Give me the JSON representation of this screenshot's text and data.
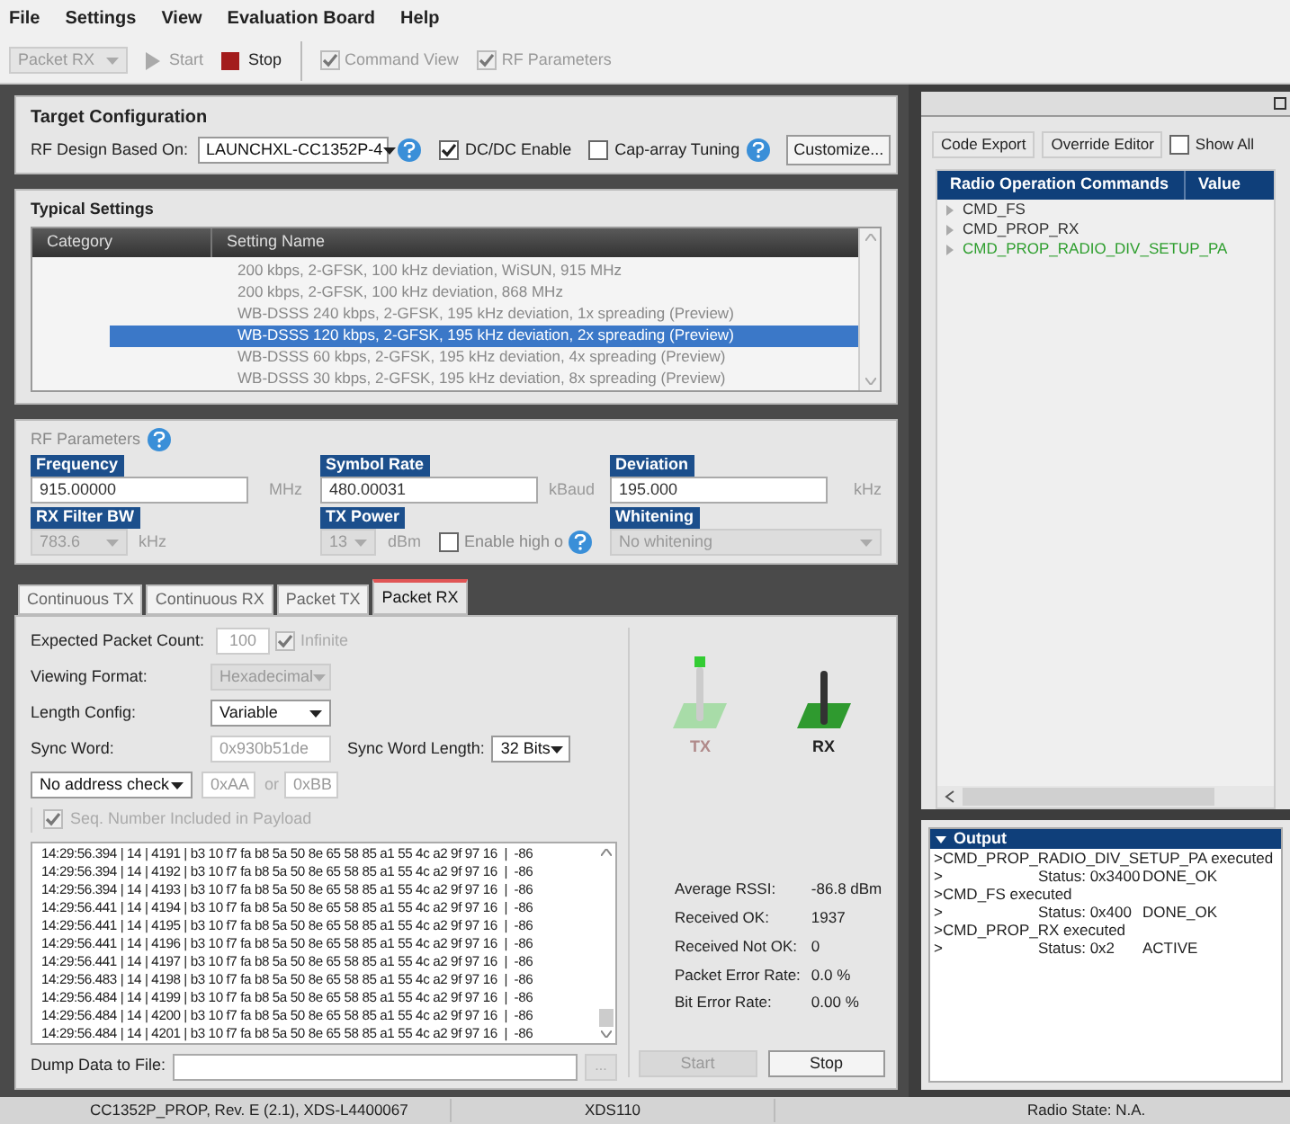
{
  "menu": [
    "File",
    "Settings",
    "View",
    "Evaluation Board",
    "Help"
  ],
  "toolbar": {
    "mode": {
      "value": "Packet RX",
      "disabled": true
    },
    "start": {
      "label": "Start",
      "disabled": true
    },
    "stop": {
      "label": "Stop",
      "disabled": false
    },
    "checks": [
      {
        "label": "Command View",
        "checked": true,
        "disabled": true
      },
      {
        "label": "RF Parameters",
        "checked": true,
        "disabled": true
      }
    ]
  },
  "target_configuration": {
    "title": "Target Configuration",
    "label": "RF Design Based On:",
    "board": "LAUNCHXL-CC1352P-4",
    "checks": [
      {
        "label": "DC/DC Enable",
        "checked": true,
        "help": false
      },
      {
        "label": "Cap-array Tuning",
        "checked": false,
        "help": true
      }
    ],
    "customize": "Customize..."
  },
  "typical_settings": {
    "title": "Typical Settings",
    "columns": [
      "Category",
      "Setting Name"
    ],
    "rows": [
      {
        "name": "200 kbps, 2-GFSK, 100 kHz deviation, WiSUN, 915 MHz",
        "selected": false
      },
      {
        "name": "200 kbps, 2-GFSK, 100 kHz deviation, 868 MHz",
        "selected": false
      },
      {
        "name": "WB-DSSS 240 kbps, 2-GFSK, 195 kHz deviation, 1x spreading (Preview)",
        "selected": false
      },
      {
        "name": "WB-DSSS 120 kbps, 2-GFSK, 195 kHz deviation, 2x spreading (Preview)",
        "selected": true
      },
      {
        "name": "WB-DSSS 60 kbps, 2-GFSK, 195 kHz deviation, 4x spreading (Preview)",
        "selected": false
      },
      {
        "name": "WB-DSSS 30 kbps, 2-GFSK, 195 kHz deviation, 8x spreading (Preview)",
        "selected": false
      }
    ]
  },
  "rf_parameters": {
    "title": "RF Parameters",
    "fields": [
      {
        "label": "Frequency",
        "value": "915.00000",
        "unit": "MHz",
        "kind": "input"
      },
      {
        "label": "Symbol Rate",
        "value": "480.00031",
        "unit": "kBaud",
        "kind": "input"
      },
      {
        "label": "Deviation",
        "value": "195.000",
        "unit": "kHz",
        "kind": "input"
      },
      {
        "label": "RX Filter BW",
        "value": "783.6",
        "unit": "kHz",
        "kind": "select"
      },
      {
        "label": "TX Power",
        "value": "13",
        "unit": "dBm",
        "kind": "select"
      },
      {
        "label": "Whitening",
        "value": "No whitening",
        "kind": "select"
      }
    ],
    "high_output": {
      "label": "Enable high o",
      "checked": false
    }
  },
  "tabs": [
    {
      "label": "Continuous TX",
      "selected": false
    },
    {
      "label": "Continuous RX",
      "selected": false
    },
    {
      "label": "Packet TX",
      "selected": false
    },
    {
      "label": "Packet RX",
      "selected": true
    }
  ],
  "packet_rx": {
    "expected_count_label": "Expected Packet Count:",
    "expected_count": "100",
    "infinite": {
      "label": "Infinite",
      "checked": true
    },
    "viewing_format_label": "Viewing Format:",
    "viewing_format": "Hexadecimal",
    "length_config_label": "Length Config:",
    "length_config": "Variable",
    "sync_word_label": "Sync Word:",
    "sync_word": "0x930b51de",
    "sync_length_label": "Sync Word Length:",
    "sync_length": "32 Bits",
    "address_check": "No address check",
    "address_1": "0xAA",
    "or": "or",
    "address_2": "0xBB",
    "seq_number": {
      "label": "Seq. Number Included in Payload",
      "checked": true
    },
    "log": [
      "14:29:56.394 | 14 | 4191 | b3 10 f7 fa b8 5a 50 8e 65 58 85 a1 55 4c a2 9f 97 16  |  -86",
      "14:29:56.394 | 14 | 4192 | b3 10 f7 fa b8 5a 50 8e 65 58 85 a1 55 4c a2 9f 97 16  |  -86",
      "14:29:56.394 | 14 | 4193 | b3 10 f7 fa b8 5a 50 8e 65 58 85 a1 55 4c a2 9f 97 16  |  -86",
      "14:29:56.441 | 14 | 4194 | b3 10 f7 fa b8 5a 50 8e 65 58 85 a1 55 4c a2 9f 97 16  |  -86",
      "14:29:56.441 | 14 | 4195 | b3 10 f7 fa b8 5a 50 8e 65 58 85 a1 55 4c a2 9f 97 16  |  -86",
      "14:29:56.441 | 14 | 4196 | b3 10 f7 fa b8 5a 50 8e 65 58 85 a1 55 4c a2 9f 97 16  |  -86",
      "14:29:56.441 | 14 | 4197 | b3 10 f7 fa b8 5a 50 8e 65 58 85 a1 55 4c a2 9f 97 16  |  -86",
      "14:29:56.483 | 14 | 4198 | b3 10 f7 fa b8 5a 50 8e 65 58 85 a1 55 4c a2 9f 97 16  |  -86",
      "14:29:56.484 | 14 | 4199 | b3 10 f7 fa b8 5a 50 8e 65 58 85 a1 55 4c a2 9f 97 16  |  -86",
      "14:29:56.484 | 14 | 4200 | b3 10 f7 fa b8 5a 50 8e 65 58 85 a1 55 4c a2 9f 97 16  |  -86",
      "14:29:56.484 | 14 | 4201 | b3 10 f7 fa b8 5a 50 8e 65 58 85 a1 55 4c a2 9f 97 16  |  -86"
    ],
    "dump_label": "Dump Data to File:",
    "browse": "...",
    "indicators": [
      {
        "label": "TX",
        "active": false
      },
      {
        "label": "RX",
        "active": true
      }
    ],
    "stats": [
      {
        "label": "Average RSSI:",
        "value": "-86.8 dBm"
      },
      {
        "label": "Received OK:",
        "value": "1937"
      },
      {
        "label": "Received Not OK:",
        "value": "0"
      },
      {
        "label": "Packet Error Rate:",
        "value": "0.0 %"
      },
      {
        "label": "Bit Error Rate:",
        "value": "0.00 %"
      }
    ],
    "start": {
      "label": "Start",
      "disabled": true
    },
    "stop": {
      "label": "Stop",
      "disabled": false
    }
  },
  "commands": {
    "buttons": [
      "Code Export",
      "Override Editor"
    ],
    "show_all": {
      "label": "Show All",
      "checked": false
    },
    "columns": [
      "Radio Operation Commands",
      "Value"
    ],
    "items": [
      {
        "name": "CMD_FS",
        "color": "#333333"
      },
      {
        "name": "CMD_PROP_RX",
        "color": "#333333"
      },
      {
        "name": "CMD_PROP_RADIO_DIV_SETUP_PA",
        "color": "#2e9e2e"
      }
    ]
  },
  "output": {
    "title": "Output",
    "lines": [
      {
        "kind": "exec",
        "text": ">CMD_PROP_RADIO_DIV_SETUP_PA executed"
      },
      {
        "kind": "status",
        "prompt": ">",
        "status": "Status: 0x3400",
        "result": "DONE_OK"
      },
      {
        "kind": "exec",
        "text": ">CMD_FS executed"
      },
      {
        "kind": "status",
        "prompt": ">",
        "status": "Status: 0x400",
        "result": "DONE_OK"
      },
      {
        "kind": "exec",
        "text": ">CMD_PROP_RX executed"
      },
      {
        "kind": "status",
        "prompt": ">",
        "status": "Status: 0x2",
        "result": "ACTIVE"
      }
    ]
  },
  "status_bar": [
    "CC1352P_PROP, Rev. E (2.1), XDS-L4400067",
    "XDS110",
    "Radio State: N.A."
  ]
}
